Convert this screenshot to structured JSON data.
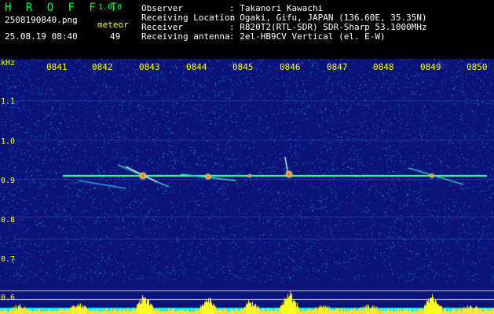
{
  "app": {
    "logo": "H R O F F T",
    "version": "1.0.0"
  },
  "capture": {
    "filename": "2508190840.png",
    "datetime": "25.08.19 08:40",
    "meteor_label": "meteor",
    "meteor_count": "49"
  },
  "station": {
    "observer_label": "Observer",
    "observer_value": ": Takanori Kawachi",
    "location_label": "Receiving Location",
    "location_value": ": Ogaki, Gifu, JAPAN (136.60E, 35.35N)",
    "receiver_label": "Receiver",
    "receiver_value": ": R820T2(RTL-SDR) SDR-Sharp 53.1000MHz",
    "antenna_label": "Receiving antenna",
    "antenna_value": ": 2el-HB9CV Vertical (el. E-W)"
  },
  "axis": {
    "unit": "kHz",
    "time_ticks": [
      "0841",
      "0842",
      "0843",
      "0844",
      "0845",
      "0846",
      "0847",
      "0848",
      "0849",
      "0850"
    ],
    "freq_ticks": [
      "1.1",
      "1.0",
      "0.9",
      "0.8",
      "0.7",
      "0.6"
    ]
  },
  "colors": {
    "text_green": "#00ff40",
    "text_yellow": "#ffff00",
    "text_white": "#ffffff",
    "background": "#000000",
    "spectrogram_bg": "#0c1378",
    "carrier": "#3cff9c"
  }
}
